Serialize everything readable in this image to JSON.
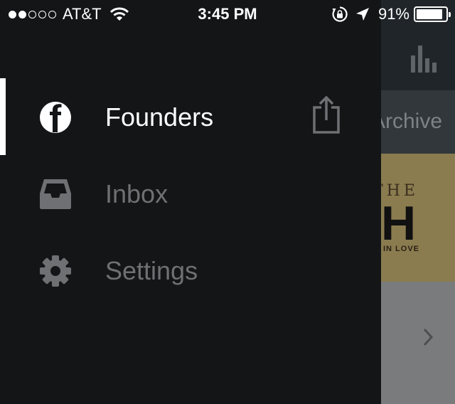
{
  "status_bar": {
    "signal_dots_filled": 2,
    "signal_dots_total": 5,
    "carrier": "AT&T",
    "time": "3:45 PM",
    "battery_percent": "91%",
    "battery_level": 0.91
  },
  "drawer": {
    "items": [
      {
        "label": "Founders",
        "icon": "founders-logo-icon",
        "active": true
      },
      {
        "label": "Inbox",
        "icon": "inbox-tray-icon",
        "active": false
      },
      {
        "label": "Settings",
        "icon": "gear-icon",
        "active": false
      }
    ],
    "share_icon": "share-icon"
  },
  "background_page": {
    "tab_label": "Archive",
    "artwork_text_top": "THE",
    "artwork_text_big": "H",
    "artwork_text_bottom": "IN LOVE"
  },
  "colors": {
    "drawer_bg": "#141517",
    "active_text": "#ffffff",
    "inactive_text": "#6e7073"
  }
}
